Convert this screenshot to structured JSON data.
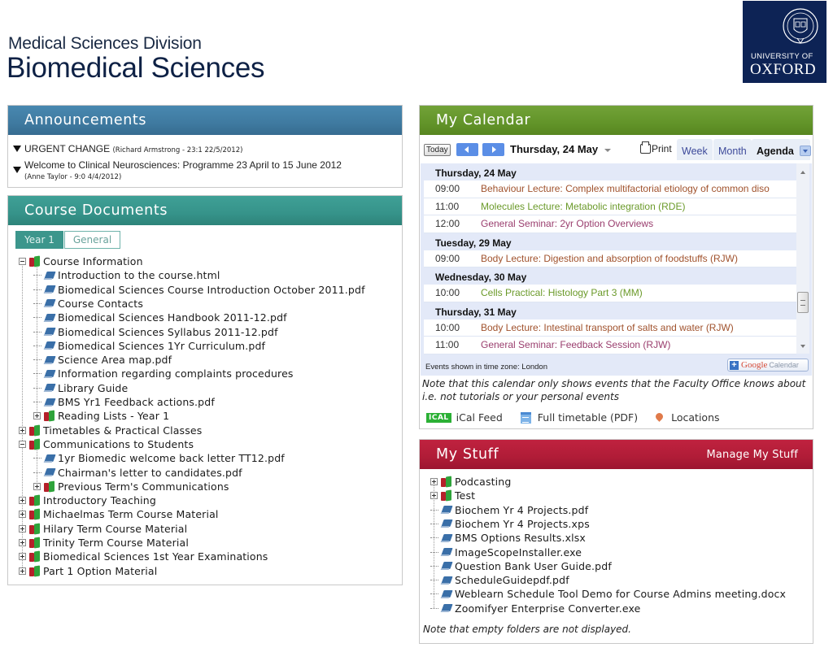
{
  "header": {
    "division": "Medical Sciences Division",
    "title": "Biomedical Sciences",
    "logo": {
      "line1": "UNIVERSITY OF",
      "line2": "OXFORD",
      "bg_color": "#0d2355"
    }
  },
  "announcements": {
    "title": "Announcements",
    "items": [
      {
        "title": "URGENT CHANGE",
        "meta": "(Richard Armstrong - 23:1 22/5/2012)"
      },
      {
        "title": "Welcome to Clinical Neurosciences: Programme 23 April to 15 June 2012",
        "meta": "(Anne Taylor - 9:0 4/4/2012)"
      }
    ]
  },
  "course_documents": {
    "title": "Course Documents",
    "tabs": [
      {
        "label": "Year 1",
        "active": true
      },
      {
        "label": "General",
        "active": false
      }
    ],
    "tree": [
      {
        "label": "Course Information",
        "type": "folder",
        "level": 0,
        "expanded": true
      },
      {
        "label": "Introduction to the course.html",
        "type": "file",
        "level": 1
      },
      {
        "label": "Biomedical Sciences Course Introduction October 2011.pdf",
        "type": "file",
        "level": 1
      },
      {
        "label": "Course Contacts",
        "type": "file",
        "level": 1
      },
      {
        "label": "Biomedical Sciences Handbook 2011-12.pdf",
        "type": "file",
        "level": 1
      },
      {
        "label": "Biomedical Sciences Syllabus 2011-12.pdf",
        "type": "file",
        "level": 1
      },
      {
        "label": "Biomedical Sciences 1Yr Curriculum.pdf",
        "type": "file",
        "level": 1
      },
      {
        "label": "Science Area map.pdf",
        "type": "file",
        "level": 1
      },
      {
        "label": "Information regarding complaints procedures",
        "type": "file",
        "level": 1
      },
      {
        "label": "Library Guide",
        "type": "file",
        "level": 1
      },
      {
        "label": "BMS Yr1 Feedback actions.pdf",
        "type": "file",
        "level": 1
      },
      {
        "label": "Reading Lists - Year 1",
        "type": "folder",
        "level": 1,
        "expanded": false
      },
      {
        "label": "Timetables & Practical Classes",
        "type": "folder",
        "level": 0,
        "expanded": false
      },
      {
        "label": "Communications to Students",
        "type": "folder",
        "level": 0,
        "expanded": true
      },
      {
        "label": "1yr Biomedic welcome back letter TT12.pdf",
        "type": "file",
        "level": 1
      },
      {
        "label": "Chairman's letter to candidates.pdf",
        "type": "file",
        "level": 1
      },
      {
        "label": "Previous Term's Communications",
        "type": "folder",
        "level": 1,
        "expanded": false
      },
      {
        "label": "Introductory Teaching",
        "type": "folder",
        "level": 0,
        "expanded": false
      },
      {
        "label": "Michaelmas Term Course Material",
        "type": "folder",
        "level": 0,
        "expanded": false
      },
      {
        "label": "Hilary Term Course Material",
        "type": "folder",
        "level": 0,
        "expanded": false
      },
      {
        "label": "Trinity Term Course Material",
        "type": "folder",
        "level": 0,
        "expanded": false
      },
      {
        "label": "Biomedical Sciences 1st Year Examinations",
        "type": "folder",
        "level": 0,
        "expanded": false
      },
      {
        "label": "Part 1 Option Material",
        "type": "folder",
        "level": 0,
        "expanded": false
      }
    ]
  },
  "calendar": {
    "title": "My Calendar",
    "today_label": "Today",
    "current_date": "Thursday, 24 May",
    "print_label": "Print",
    "views": [
      {
        "label": "Week",
        "active": false
      },
      {
        "label": "Month",
        "active": false
      },
      {
        "label": "Agenda",
        "active": true
      }
    ],
    "agenda": [
      {
        "day": "Thursday, 24 May",
        "events": [
          {
            "time": "09:00",
            "title": "Behaviour Lecture: Complex multifactorial etiology of common diso",
            "color": "#a0522d"
          },
          {
            "time": "11:00",
            "title": "Molecules Lecture: Metabolic integration (RDE)",
            "color": "#6b9a2a"
          },
          {
            "time": "12:00",
            "title": "General Seminar: 2yr Option Overviews",
            "color": "#9a3e6e"
          }
        ]
      },
      {
        "day": "Tuesday, 29 May",
        "events": [
          {
            "time": "09:00",
            "title": "Body Lecture: Digestion and absorption of foodstuffs (RJW)",
            "color": "#a0522d"
          }
        ]
      },
      {
        "day": "Wednesday, 30 May",
        "events": [
          {
            "time": "10:00",
            "title": "Cells Practical: Histology Part 3 (MM)",
            "color": "#6b9a2a"
          }
        ]
      },
      {
        "day": "Thursday, 31 May",
        "events": [
          {
            "time": "10:00",
            "title": "Body Lecture: Intestinal transport of salts and water (RJW)",
            "color": "#a0522d"
          },
          {
            "time": "11:00",
            "title": "General Seminar: Feedback Session (RJW)",
            "color": "#9a3e6e"
          }
        ]
      }
    ],
    "timezone_text": "Events shown in time zone: London",
    "gcal_button": {
      "google": "Google",
      "calendar": "Calendar"
    },
    "note": "Note that this calendar only shows events that the Faculty Office knows about i.e. not tutorials or your personal events",
    "links": {
      "ical_badge": "ICAL",
      "ical": "iCal Feed",
      "timetable": "Full timetable (PDF)",
      "locations": "Locations"
    }
  },
  "my_stuff": {
    "title": "My Stuff",
    "manage_label": "Manage My Stuff",
    "tree": [
      {
        "label": "Podcasting",
        "type": "folder",
        "level": 0,
        "expanded": false
      },
      {
        "label": "Test",
        "type": "folder",
        "level": 0,
        "expanded": false
      },
      {
        "label": "Biochem Yr 4 Projects.pdf",
        "type": "file",
        "level": 0
      },
      {
        "label": "Biochem Yr 4 Projects.xps",
        "type": "file",
        "level": 0
      },
      {
        "label": "BMS Options Results.xlsx",
        "type": "file",
        "level": 0
      },
      {
        "label": "ImageScopeInstaller.exe",
        "type": "file",
        "level": 0
      },
      {
        "label": "Question Bank User Guide.pdf",
        "type": "file",
        "level": 0
      },
      {
        "label": "ScheduleGuidepdf.pdf",
        "type": "file",
        "level": 0
      },
      {
        "label": "Weblearn Schedule Tool Demo for Course Admins meeting.docx",
        "type": "file",
        "level": 0
      },
      {
        "label": "Zoomifyer Enterprise Converter.exe",
        "type": "file",
        "level": 0
      }
    ],
    "note": "Note that empty folders are not displayed."
  },
  "colors": {
    "announcements_header": "#3f7aa0",
    "documents_header": "#36938a",
    "calendar_header": "#629429",
    "mystuff_header": "#b01c37"
  }
}
